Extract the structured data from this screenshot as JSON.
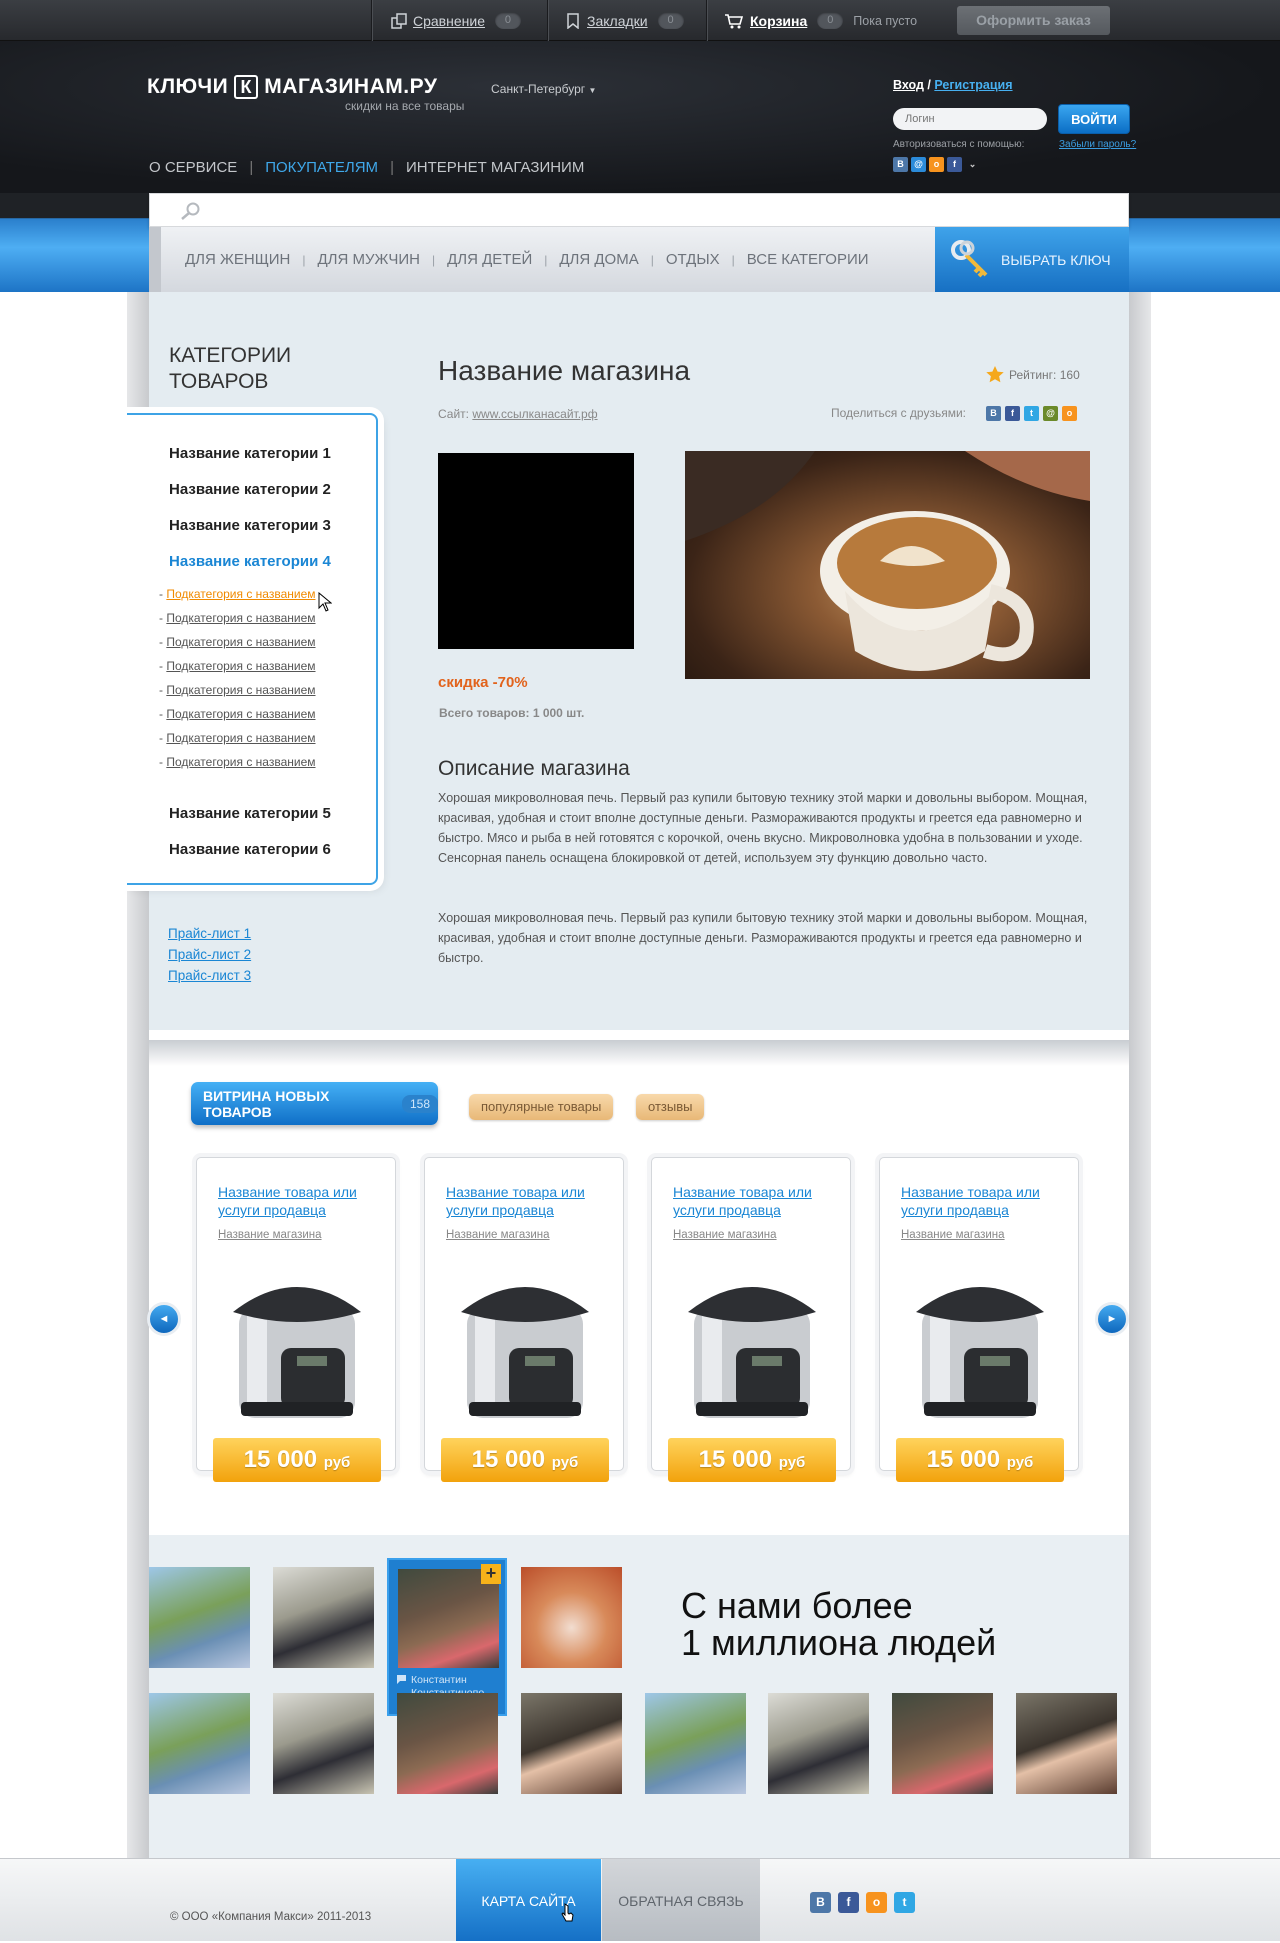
{
  "topbar": {
    "compare_label": "Сравнение",
    "compare_count": "0",
    "bookmarks_label": "Закладки",
    "bookmarks_count": "0",
    "cart_label": "Корзина",
    "cart_count": "0",
    "cart_status": "Пока пусто",
    "order_button": "Оформить заказ"
  },
  "header": {
    "logo_part1": "КЛЮЧИ",
    "logo_letter": "К",
    "logo_part2": "МАГАЗИНАМ.РУ",
    "city": "Санкт-Петербург",
    "tagline": "скидки на все товары",
    "nav": [
      "О СЕРВИСЕ",
      "ПОКУПАТЕЛЯМ",
      "ИНТЕРНЕТ МАГАЗИНИМ"
    ],
    "login_link": "Вход",
    "register_link": "Регистрация",
    "login_placeholder": "Логин",
    "login_button": "ВОЙТИ",
    "auth_via": "Авторизоваться с помощью:",
    "forgot": "Забыли пароль?"
  },
  "catnav": {
    "items": [
      "ДЛЯ ЖЕНЩИН",
      "ДЛЯ МУЖЧИН",
      "ДЛЯ ДЕТЕЙ",
      "ДЛЯ ДОМА",
      "ОТДЫХ",
      "ВСЕ КАТЕГОРИИ"
    ],
    "key_button": "ВЫБРАТЬ КЛЮЧ"
  },
  "sidebar": {
    "title": "КАТЕГОРИИ ТОВАРОВ",
    "categories": [
      "Название категории 1",
      "Название категории 2",
      "Название категории 3",
      "Название категории 4",
      "Название категории 5",
      "Название категории 6"
    ],
    "subcategory": "Подкатегория с названием",
    "price_lists": [
      "Прайс-лист 1",
      "Прайс-лист 2",
      "Прайс-лист 3"
    ]
  },
  "shop": {
    "title": "Название магазина",
    "rating": "Рейтинг: 160",
    "site_label": "Сайт:",
    "site_url": "www.ссылканасайт.рф",
    "share_label": "Поделиться с друзьями:",
    "discount": "скидка -70%",
    "total": "Всего товаров: 1 000 шт.",
    "desc_title": "Описание магазина",
    "desc_1": "Хорошая микроволновая печь. Первый раз купили бытовую технику этой марки и довольны выбором. Мощная, красивая, удобная и стоит вполне доступные деньги. Размораживаются продукты и греется еда равномерно и быстро. Мясо и рыба в ней готовятся с корочкой, очень вкусно. Микроволновка удобна в пользовании и уходе. Сенсорная панель оснащена блокировкой от детей, используем эту функцию довольно часто.",
    "desc_2": "Хорошая микроволновая печь. Первый раз купили бытовую технику этой марки и довольны выбором. Мощная, красивая, удобная и стоит вполне доступные деньги. Размораживаются продукты и греется еда равномерно и быстро."
  },
  "showcase": {
    "tab_main": "ВИТРИНА НОВЫХ ТОВАРОВ",
    "tab_count": "158",
    "tab_popular": "популярные товары",
    "tab_reviews": "отзывы",
    "product_name": "Название товара или услуги продавца",
    "product_shop": "Название магазина",
    "price": "15 000",
    "currency": "руб",
    "prev_arrow": "◄",
    "next_arrow": "►"
  },
  "people": {
    "selected_name_1": "Константин",
    "selected_name_2": "Константинопо",
    "slogan_1": "С нами более",
    "slogan_2": "1 миллиона людей"
  },
  "footer": {
    "copyright": "© ООО «Компания Макси» 2011-2013",
    "sitemap": "КАРТА САЙТА",
    "feedback": "ОБРАТНАЯ СВЯЗЬ"
  }
}
